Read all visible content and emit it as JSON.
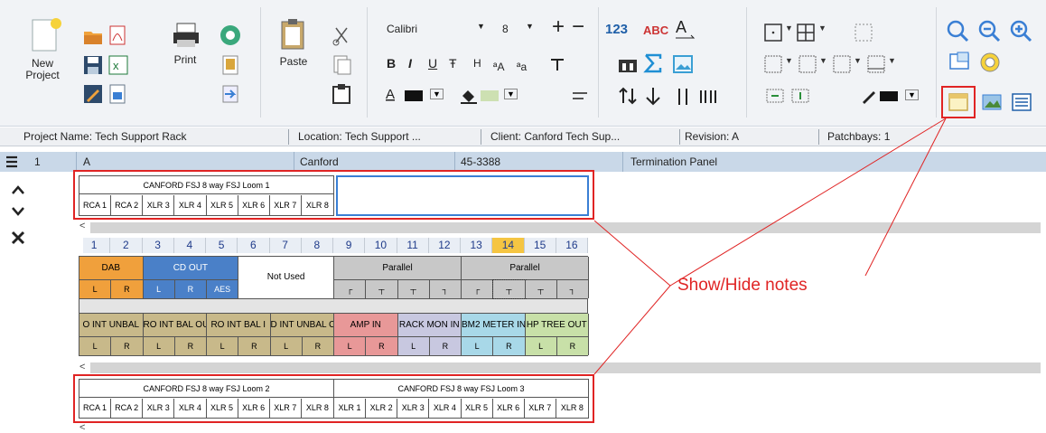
{
  "ribbon": {
    "new_project": "New\nProject",
    "print": "Print",
    "paste": "Paste",
    "font_name": "Calibri",
    "font_size": "8",
    "format_bold": "B",
    "format_italic": "I",
    "format_underline": "U",
    "format_strike": "Ŧ",
    "format_h": "H",
    "count_icon_text": "123",
    "abc_icon_text": "ABC",
    "plus": "+",
    "minus": "−"
  },
  "infobar": {
    "project": "Project Name: Tech Support Rack",
    "location": "Location: Tech Support ...",
    "client": "Client: Canford Tech Sup...",
    "revision": "Revision: A",
    "patchbays": "Patchbays: 1"
  },
  "header": {
    "row_num": "1",
    "col_a": "A",
    "manufacturer": "Canford",
    "part": "45-3388",
    "description": "Termination Panel"
  },
  "loom1": {
    "title": "CANFORD FSJ 8 way FSJ Loom 1",
    "cells": [
      "RCA 1",
      "RCA 2",
      "XLR 3",
      "XLR 4",
      "XLR 5",
      "XLR 6",
      "XLR 7",
      "XLR 8"
    ]
  },
  "patch": {
    "numbers": [
      "1",
      "2",
      "3",
      "4",
      "5",
      "6",
      "7",
      "8",
      "9",
      "10",
      "11",
      "12",
      "13",
      "14",
      "15",
      "16"
    ],
    "top_groups": [
      {
        "label": "DAB",
        "color": "#f0a03c",
        "span": 2
      },
      {
        "label": "CD OUT",
        "color": "#4a80c8",
        "span": 3
      },
      {
        "label": "Not Used",
        "color": "#ffffff",
        "span": 3
      },
      {
        "label": "Parallel",
        "color": "#c8c8c8",
        "span": 4
      },
      {
        "label": "Parallel",
        "color": "#c8c8c8",
        "span": 4
      }
    ],
    "top_sub": [
      "L",
      "R",
      "L",
      "R",
      "AES",
      "",
      "",
      "",
      "┌",
      "┬",
      "┬",
      "┐",
      "┌",
      "┬",
      "┬",
      "┐"
    ],
    "bottom_groups": [
      {
        "label": "O INT UNBAL",
        "color": "#c8b98a",
        "span": 2
      },
      {
        "label": "RO INT BAL OU",
        "color": "#c8b98a",
        "span": 2
      },
      {
        "label": "RO INT BAL I",
        "color": "#c8b98a",
        "span": 2
      },
      {
        "label": "D INT UNBAL C",
        "color": "#c8b98a",
        "span": 2
      },
      {
        "label": "AMP  IN",
        "color": "#e89898",
        "span": 2
      },
      {
        "label": "RACK MON IN",
        "color": "#c8c8e0",
        "span": 2
      },
      {
        "label": "BM2 METER IN",
        "color": "#a8d8e8",
        "span": 2
      },
      {
        "label": "HP TREE OUT",
        "color": "#c8e0a8",
        "span": 2
      }
    ],
    "bottom_sub": [
      "L",
      "R",
      "L",
      "R",
      "L",
      "R",
      "L",
      "R",
      "L",
      "R",
      "L",
      "R",
      "L",
      "R",
      "L",
      "R"
    ]
  },
  "loom2": {
    "title": "CANFORD FSJ 8 way FSJ Loom 2",
    "cells": [
      "RCA 1",
      "RCA 2",
      "XLR 3",
      "XLR 4",
      "XLR 5",
      "XLR 6",
      "XLR 7",
      "XLR 8"
    ]
  },
  "loom3": {
    "title": "CANFORD FSJ 8 way FSJ Loom 3",
    "cells": [
      "XLR 1",
      "XLR 2",
      "XLR 3",
      "XLR 4",
      "XLR 5",
      "XLR 6",
      "XLR 7",
      "XLR 8"
    ]
  },
  "annotation": "Show/Hide notes",
  "colors": {
    "accent_red": "#e02424",
    "header_blue": "#c9d8e8",
    "selection_blue": "#3a7fd4",
    "highlight_orange": "#f5c542"
  }
}
